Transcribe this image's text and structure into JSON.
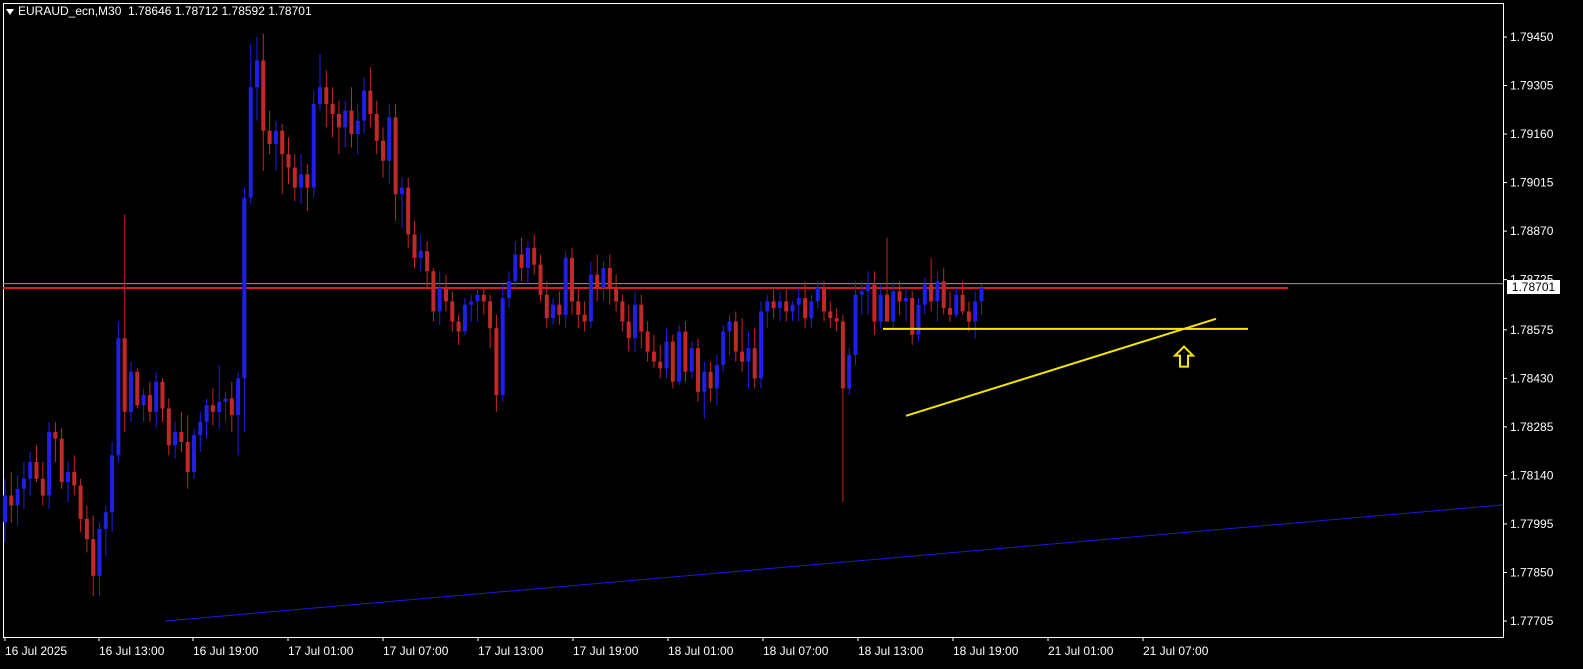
{
  "header": {
    "symbol": "EURAUD_ecn,M30",
    "open": "1.78646",
    "high": "1.78712",
    "low": "1.78592",
    "close": "1.78701"
  },
  "current_price_label": "1.78701",
  "colors": {
    "background": "#000000",
    "bull_candle": "#1f1fe6",
    "bear_candle": "#c0282a",
    "frame": "#ffffff",
    "horizontal_level": "#d51e1e",
    "support_lines": "#f5e600",
    "long_trendline": "#1a1ad9",
    "arrow": "#f5e600"
  },
  "chart_data": {
    "type": "candlestick",
    "symbol": "EURAUD_ecn",
    "timeframe": "M30",
    "y_ticks": [
      "1.79450",
      "1.79305",
      "1.79160",
      "1.79015",
      "1.78870",
      "1.78725",
      "1.78575",
      "1.78430",
      "1.78285",
      "1.78140",
      "1.77995",
      "1.77850",
      "1.77705"
    ],
    "ylim": [
      1.7766,
      1.7963
    ],
    "x_tick_labels": [
      "16 Jul 2025",
      "16 Jul 13:00",
      "16 Jul 19:00",
      "17 Jul 01:00",
      "17 Jul 07:00",
      "17 Jul 13:00",
      "17 Jul 19:00",
      "18 Jul 01:00",
      "18 Jul 07:00",
      "18 Jul 13:00",
      "18 Jul 19:00",
      "21 Jul 01:00",
      "21 Jul 07:00"
    ],
    "horizontal_level": 1.787,
    "current_price": 1.78701,
    "candles": [
      {
        "o": 1.78,
        "h": 1.7813,
        "l": 1.7794,
        "c": 1.7808
      },
      {
        "o": 1.7808,
        "h": 1.7815,
        "l": 1.78,
        "c": 1.7805
      },
      {
        "o": 1.7805,
        "h": 1.7814,
        "l": 1.7799,
        "c": 1.781
      },
      {
        "o": 1.781,
        "h": 1.7818,
        "l": 1.7804,
        "c": 1.7813
      },
      {
        "o": 1.7813,
        "h": 1.7821,
        "l": 1.7808,
        "c": 1.7818
      },
      {
        "o": 1.7818,
        "h": 1.7823,
        "l": 1.7812,
        "c": 1.7813
      },
      {
        "o": 1.7813,
        "h": 1.7818,
        "l": 1.7805,
        "c": 1.7808
      },
      {
        "o": 1.7808,
        "h": 1.783,
        "l": 1.7804,
        "c": 1.7827
      },
      {
        "o": 1.7827,
        "h": 1.783,
        "l": 1.7818,
        "c": 1.7825
      },
      {
        "o": 1.7825,
        "h": 1.7828,
        "l": 1.781,
        "c": 1.7812
      },
      {
        "o": 1.7812,
        "h": 1.7818,
        "l": 1.7806,
        "c": 1.7815
      },
      {
        "o": 1.7815,
        "h": 1.782,
        "l": 1.7808,
        "c": 1.7811
      },
      {
        "o": 1.7811,
        "h": 1.7813,
        "l": 1.7797,
        "c": 1.7801
      },
      {
        "o": 1.7801,
        "h": 1.7805,
        "l": 1.7791,
        "c": 1.7795
      },
      {
        "o": 1.7795,
        "h": 1.7802,
        "l": 1.7778,
        "c": 1.7784
      },
      {
        "o": 1.7784,
        "h": 1.78,
        "l": 1.7778,
        "c": 1.7798
      },
      {
        "o": 1.7798,
        "h": 1.7805,
        "l": 1.779,
        "c": 1.7803
      },
      {
        "o": 1.7803,
        "h": 1.7824,
        "l": 1.7797,
        "c": 1.782
      },
      {
        "o": 1.782,
        "h": 1.786,
        "l": 1.7818,
        "c": 1.7855
      },
      {
        "o": 1.7855,
        "h": 1.7892,
        "l": 1.7827,
        "c": 1.7833
      },
      {
        "o": 1.7833,
        "h": 1.7848,
        "l": 1.783,
        "c": 1.7845
      },
      {
        "o": 1.7845,
        "h": 1.7846,
        "l": 1.7834,
        "c": 1.7835
      },
      {
        "o": 1.7835,
        "h": 1.784,
        "l": 1.783,
        "c": 1.7838
      },
      {
        "o": 1.7838,
        "h": 1.7842,
        "l": 1.783,
        "c": 1.7833
      },
      {
        "o": 1.7833,
        "h": 1.7845,
        "l": 1.7828,
        "c": 1.7842
      },
      {
        "o": 1.7842,
        "h": 1.7843,
        "l": 1.783,
        "c": 1.7834
      },
      {
        "o": 1.7834,
        "h": 1.7837,
        "l": 1.782,
        "c": 1.7823
      },
      {
        "o": 1.7823,
        "h": 1.783,
        "l": 1.7819,
        "c": 1.7827
      },
      {
        "o": 1.7827,
        "h": 1.7833,
        "l": 1.7821,
        "c": 1.7824
      },
      {
        "o": 1.7824,
        "h": 1.7832,
        "l": 1.781,
        "c": 1.7815
      },
      {
        "o": 1.7815,
        "h": 1.7828,
        "l": 1.7813,
        "c": 1.7826
      },
      {
        "o": 1.7826,
        "h": 1.7833,
        "l": 1.7821,
        "c": 1.783
      },
      {
        "o": 1.783,
        "h": 1.7837,
        "l": 1.7825,
        "c": 1.7835
      },
      {
        "o": 1.7835,
        "h": 1.784,
        "l": 1.7829,
        "c": 1.7833
      },
      {
        "o": 1.7833,
        "h": 1.7847,
        "l": 1.7828,
        "c": 1.7836
      },
      {
        "o": 1.7836,
        "h": 1.7839,
        "l": 1.783,
        "c": 1.7837
      },
      {
        "o": 1.7837,
        "h": 1.7842,
        "l": 1.7827,
        "c": 1.7832
      },
      {
        "o": 1.7832,
        "h": 1.7845,
        "l": 1.782,
        "c": 1.7843
      },
      {
        "o": 1.7843,
        "h": 1.79,
        "l": 1.7827,
        "c": 1.7897
      },
      {
        "o": 1.7897,
        "h": 1.7943,
        "l": 1.7895,
        "c": 1.793
      },
      {
        "o": 1.793,
        "h": 1.7945,
        "l": 1.792,
        "c": 1.7938
      },
      {
        "o": 1.7938,
        "h": 1.7946,
        "l": 1.7905,
        "c": 1.7917
      },
      {
        "o": 1.7917,
        "h": 1.7923,
        "l": 1.791,
        "c": 1.7913
      },
      {
        "o": 1.7913,
        "h": 1.792,
        "l": 1.7905,
        "c": 1.7917
      },
      {
        "o": 1.7917,
        "h": 1.7919,
        "l": 1.7898,
        "c": 1.791
      },
      {
        "o": 1.791,
        "h": 1.7915,
        "l": 1.7901,
        "c": 1.7906
      },
      {
        "o": 1.7906,
        "h": 1.791,
        "l": 1.7896,
        "c": 1.79
      },
      {
        "o": 1.79,
        "h": 1.791,
        "l": 1.7895,
        "c": 1.7904
      },
      {
        "o": 1.7904,
        "h": 1.7907,
        "l": 1.7893,
        "c": 1.79
      },
      {
        "o": 1.79,
        "h": 1.7929,
        "l": 1.7897,
        "c": 1.7925
      },
      {
        "o": 1.7925,
        "h": 1.794,
        "l": 1.7923,
        "c": 1.793
      },
      {
        "o": 1.793,
        "h": 1.7935,
        "l": 1.7918,
        "c": 1.7925
      },
      {
        "o": 1.7925,
        "h": 1.793,
        "l": 1.7915,
        "c": 1.7922
      },
      {
        "o": 1.7922,
        "h": 1.7926,
        "l": 1.791,
        "c": 1.7918
      },
      {
        "o": 1.7918,
        "h": 1.7926,
        "l": 1.7912,
        "c": 1.7923
      },
      {
        "o": 1.7923,
        "h": 1.793,
        "l": 1.7912,
        "c": 1.7916
      },
      {
        "o": 1.7916,
        "h": 1.7925,
        "l": 1.791,
        "c": 1.792
      },
      {
        "o": 1.792,
        "h": 1.7933,
        "l": 1.7916,
        "c": 1.7929
      },
      {
        "o": 1.7929,
        "h": 1.7936,
        "l": 1.7918,
        "c": 1.7922
      },
      {
        "o": 1.7922,
        "h": 1.7926,
        "l": 1.791,
        "c": 1.7914
      },
      {
        "o": 1.7914,
        "h": 1.7918,
        "l": 1.7903,
        "c": 1.7908
      },
      {
        "o": 1.7908,
        "h": 1.7925,
        "l": 1.7901,
        "c": 1.7921
      },
      {
        "o": 1.7921,
        "h": 1.7925,
        "l": 1.789,
        "c": 1.7898
      },
      {
        "o": 1.7898,
        "h": 1.7903,
        "l": 1.7888,
        "c": 1.79
      },
      {
        "o": 1.79,
        "h": 1.7903,
        "l": 1.7882,
        "c": 1.7886
      },
      {
        "o": 1.7886,
        "h": 1.789,
        "l": 1.7876,
        "c": 1.7879
      },
      {
        "o": 1.7879,
        "h": 1.7886,
        "l": 1.7875,
        "c": 1.7881
      },
      {
        "o": 1.7881,
        "h": 1.7884,
        "l": 1.787,
        "c": 1.7875
      },
      {
        "o": 1.7875,
        "h": 1.7876,
        "l": 1.786,
        "c": 1.7863
      },
      {
        "o": 1.7863,
        "h": 1.7875,
        "l": 1.7859,
        "c": 1.787
      },
      {
        "o": 1.787,
        "h": 1.7874,
        "l": 1.7863,
        "c": 1.7866
      },
      {
        "o": 1.7866,
        "h": 1.7869,
        "l": 1.7857,
        "c": 1.786
      },
      {
        "o": 1.786,
        "h": 1.7862,
        "l": 1.7853,
        "c": 1.7857
      },
      {
        "o": 1.7857,
        "h": 1.7867,
        "l": 1.7856,
        "c": 1.7865
      },
      {
        "o": 1.7865,
        "h": 1.7868,
        "l": 1.786,
        "c": 1.7866
      },
      {
        "o": 1.7866,
        "h": 1.787,
        "l": 1.786,
        "c": 1.7868
      },
      {
        "o": 1.7868,
        "h": 1.787,
        "l": 1.7862,
        "c": 1.7866
      },
      {
        "o": 1.7866,
        "h": 1.7868,
        "l": 1.7852,
        "c": 1.7858
      },
      {
        "o": 1.7858,
        "h": 1.7862,
        "l": 1.7833,
        "c": 1.7838
      },
      {
        "o": 1.7838,
        "h": 1.7871,
        "l": 1.7836,
        "c": 1.7867
      },
      {
        "o": 1.7867,
        "h": 1.7875,
        "l": 1.7864,
        "c": 1.7872
      },
      {
        "o": 1.7872,
        "h": 1.7884,
        "l": 1.787,
        "c": 1.788
      },
      {
        "o": 1.788,
        "h": 1.7885,
        "l": 1.7872,
        "c": 1.7876
      },
      {
        "o": 1.7876,
        "h": 1.7884,
        "l": 1.7871,
        "c": 1.7882
      },
      {
        "o": 1.7882,
        "h": 1.7886,
        "l": 1.7874,
        "c": 1.7877
      },
      {
        "o": 1.7877,
        "h": 1.788,
        "l": 1.7866,
        "c": 1.7868
      },
      {
        "o": 1.7868,
        "h": 1.7872,
        "l": 1.7858,
        "c": 1.7861
      },
      {
        "o": 1.7861,
        "h": 1.7867,
        "l": 1.7859,
        "c": 1.7865
      },
      {
        "o": 1.7865,
        "h": 1.7869,
        "l": 1.7859,
        "c": 1.7862
      },
      {
        "o": 1.7862,
        "h": 1.7881,
        "l": 1.7858,
        "c": 1.7879
      },
      {
        "o": 1.7879,
        "h": 1.7882,
        "l": 1.7862,
        "c": 1.7866
      },
      {
        "o": 1.7866,
        "h": 1.787,
        "l": 1.7858,
        "c": 1.7862
      },
      {
        "o": 1.7862,
        "h": 1.7866,
        "l": 1.7857,
        "c": 1.786
      },
      {
        "o": 1.786,
        "h": 1.7878,
        "l": 1.7858,
        "c": 1.7874
      },
      {
        "o": 1.7874,
        "h": 1.788,
        "l": 1.7866,
        "c": 1.787
      },
      {
        "o": 1.787,
        "h": 1.7878,
        "l": 1.7866,
        "c": 1.7876
      },
      {
        "o": 1.7876,
        "h": 1.788,
        "l": 1.7865,
        "c": 1.787
      },
      {
        "o": 1.787,
        "h": 1.7874,
        "l": 1.7863,
        "c": 1.7866
      },
      {
        "o": 1.7866,
        "h": 1.7868,
        "l": 1.7857,
        "c": 1.786
      },
      {
        "o": 1.786,
        "h": 1.7865,
        "l": 1.7851,
        "c": 1.7855
      },
      {
        "o": 1.7855,
        "h": 1.7869,
        "l": 1.7851,
        "c": 1.7865
      },
      {
        "o": 1.7865,
        "h": 1.7868,
        "l": 1.7852,
        "c": 1.7857
      },
      {
        "o": 1.7857,
        "h": 1.786,
        "l": 1.7848,
        "c": 1.7851
      },
      {
        "o": 1.7851,
        "h": 1.7856,
        "l": 1.7846,
        "c": 1.7848
      },
      {
        "o": 1.7848,
        "h": 1.7853,
        "l": 1.7843,
        "c": 1.7846
      },
      {
        "o": 1.7846,
        "h": 1.7858,
        "l": 1.7843,
        "c": 1.7854
      },
      {
        "o": 1.7854,
        "h": 1.7856,
        "l": 1.784,
        "c": 1.7842
      },
      {
        "o": 1.7842,
        "h": 1.7859,
        "l": 1.7841,
        "c": 1.7857
      },
      {
        "o": 1.7857,
        "h": 1.786,
        "l": 1.7842,
        "c": 1.7845
      },
      {
        "o": 1.7845,
        "h": 1.7854,
        "l": 1.7843,
        "c": 1.7852
      },
      {
        "o": 1.7852,
        "h": 1.7855,
        "l": 1.7836,
        "c": 1.7839
      },
      {
        "o": 1.7839,
        "h": 1.7848,
        "l": 1.7831,
        "c": 1.7845
      },
      {
        "o": 1.7845,
        "h": 1.7848,
        "l": 1.7836,
        "c": 1.784
      },
      {
        "o": 1.784,
        "h": 1.785,
        "l": 1.7835,
        "c": 1.7847
      },
      {
        "o": 1.7847,
        "h": 1.7859,
        "l": 1.7845,
        "c": 1.7857
      },
      {
        "o": 1.7857,
        "h": 1.7862,
        "l": 1.785,
        "c": 1.786
      },
      {
        "o": 1.786,
        "h": 1.7863,
        "l": 1.7848,
        "c": 1.7851
      },
      {
        "o": 1.7851,
        "h": 1.7861,
        "l": 1.7845,
        "c": 1.7848
      },
      {
        "o": 1.7848,
        "h": 1.7857,
        "l": 1.784,
        "c": 1.7852
      },
      {
        "o": 1.7852,
        "h": 1.7858,
        "l": 1.784,
        "c": 1.7843
      },
      {
        "o": 1.7843,
        "h": 1.7866,
        "l": 1.784,
        "c": 1.7863
      },
      {
        "o": 1.7863,
        "h": 1.7868,
        "l": 1.7858,
        "c": 1.7866
      },
      {
        "o": 1.7866,
        "h": 1.787,
        "l": 1.7861,
        "c": 1.7864
      },
      {
        "o": 1.7864,
        "h": 1.7869,
        "l": 1.786,
        "c": 1.7866
      },
      {
        "o": 1.7866,
        "h": 1.787,
        "l": 1.786,
        "c": 1.7863
      },
      {
        "o": 1.7863,
        "h": 1.7866,
        "l": 1.786,
        "c": 1.7865
      },
      {
        "o": 1.7865,
        "h": 1.787,
        "l": 1.786,
        "c": 1.7867
      },
      {
        "o": 1.7867,
        "h": 1.7872,
        "l": 1.7858,
        "c": 1.7861
      },
      {
        "o": 1.7861,
        "h": 1.7868,
        "l": 1.7858,
        "c": 1.7866
      },
      {
        "o": 1.7866,
        "h": 1.7872,
        "l": 1.7864,
        "c": 1.787
      },
      {
        "o": 1.787,
        "h": 1.7872,
        "l": 1.786,
        "c": 1.7863
      },
      {
        "o": 1.7863,
        "h": 1.7866,
        "l": 1.7858,
        "c": 1.7861
      },
      {
        "o": 1.7861,
        "h": 1.7864,
        "l": 1.7857,
        "c": 1.786
      },
      {
        "o": 1.786,
        "h": 1.7862,
        "l": 1.7806,
        "c": 1.784
      },
      {
        "o": 1.784,
        "h": 1.7852,
        "l": 1.7838,
        "c": 1.785
      },
      {
        "o": 1.785,
        "h": 1.7872,
        "l": 1.7847,
        "c": 1.7868
      },
      {
        "o": 1.7868,
        "h": 1.7872,
        "l": 1.7862,
        "c": 1.7869
      },
      {
        "o": 1.7869,
        "h": 1.7875,
        "l": 1.7862,
        "c": 1.7871
      },
      {
        "o": 1.7871,
        "h": 1.7875,
        "l": 1.7856,
        "c": 1.786
      },
      {
        "o": 1.786,
        "h": 1.7871,
        "l": 1.7858,
        "c": 1.7868
      },
      {
        "o": 1.7868,
        "h": 1.7885,
        "l": 1.7862,
        "c": 1.786
      },
      {
        "o": 1.786,
        "h": 1.7872,
        "l": 1.7858,
        "c": 1.7869
      },
      {
        "o": 1.7869,
        "h": 1.7872,
        "l": 1.7862,
        "c": 1.7866
      },
      {
        "o": 1.7866,
        "h": 1.787,
        "l": 1.786,
        "c": 1.7867
      },
      {
        "o": 1.7867,
        "h": 1.7869,
        "l": 1.7853,
        "c": 1.7856
      },
      {
        "o": 1.7856,
        "h": 1.7867,
        "l": 1.7854,
        "c": 1.7865
      },
      {
        "o": 1.7865,
        "h": 1.7873,
        "l": 1.7862,
        "c": 1.7871
      },
      {
        "o": 1.7871,
        "h": 1.7879,
        "l": 1.7863,
        "c": 1.7866
      },
      {
        "o": 1.7866,
        "h": 1.7875,
        "l": 1.786,
        "c": 1.7872
      },
      {
        "o": 1.7872,
        "h": 1.7876,
        "l": 1.7862,
        "c": 1.7864
      },
      {
        "o": 1.7864,
        "h": 1.7869,
        "l": 1.786,
        "c": 1.7862
      },
      {
        "o": 1.7862,
        "h": 1.787,
        "l": 1.7861,
        "c": 1.7868
      },
      {
        "o": 1.7868,
        "h": 1.7872,
        "l": 1.7862,
        "c": 1.7863
      },
      {
        "o": 1.7863,
        "h": 1.7866,
        "l": 1.7857,
        "c": 1.786
      },
      {
        "o": 1.786,
        "h": 1.7869,
        "l": 1.7855,
        "c": 1.7866
      },
      {
        "o": 1.7866,
        "h": 1.7871,
        "l": 1.7862,
        "c": 1.787
      }
    ]
  }
}
